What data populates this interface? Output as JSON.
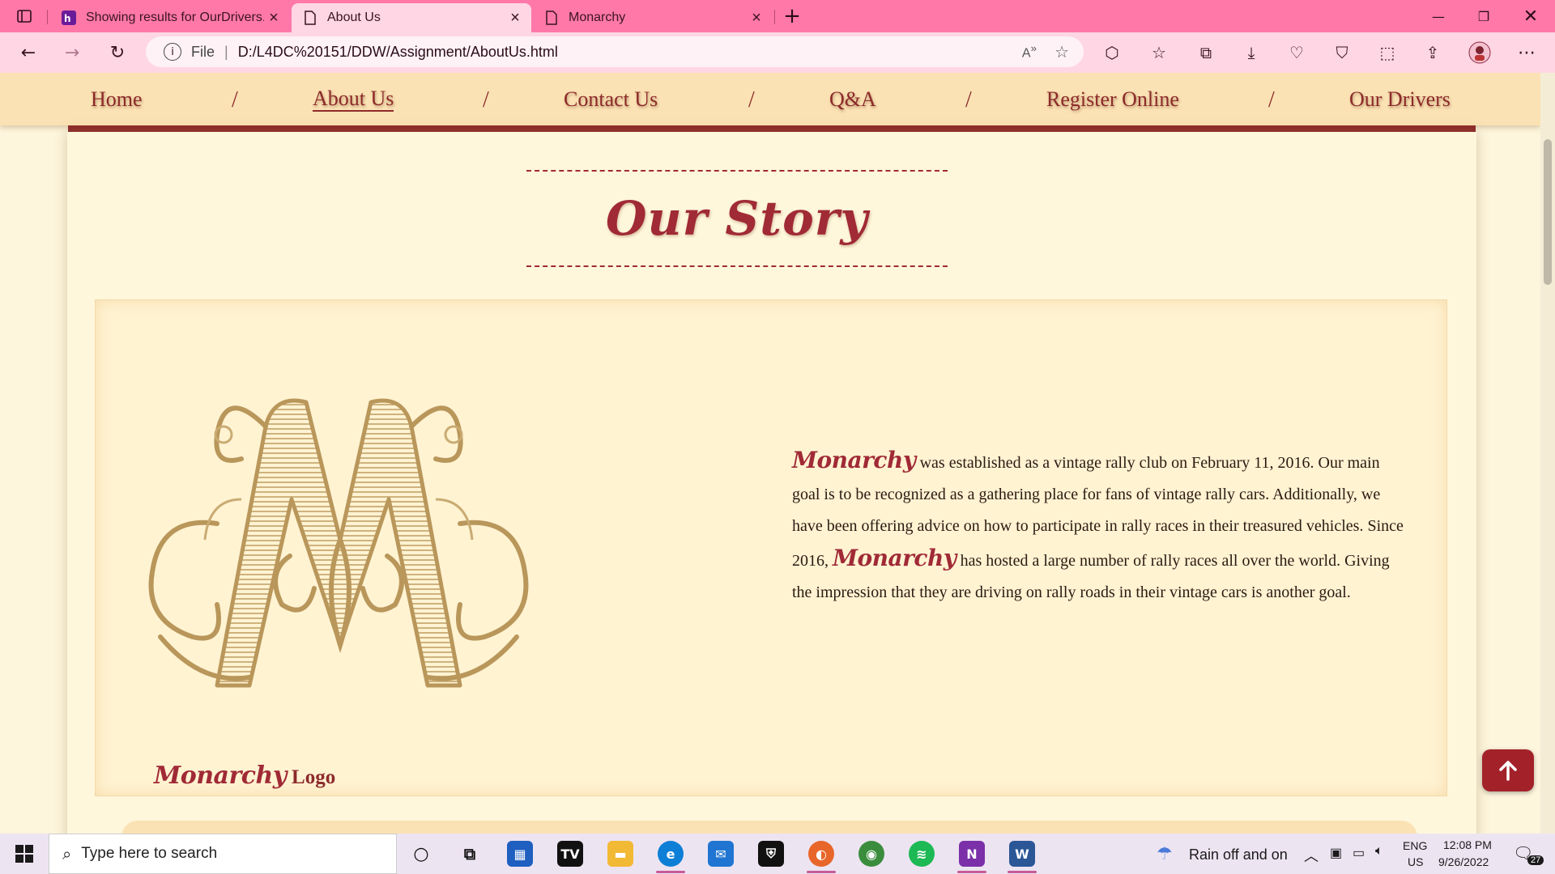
{
  "browser": {
    "tabs": [
      {
        "title": "Showing results for OurDrivers.h",
        "active": false
      },
      {
        "title": "About Us",
        "active": true
      },
      {
        "title": "Monarchy",
        "active": false
      }
    ],
    "new_tab_label": "+",
    "address": {
      "scheme_label": "File",
      "url": "D:/L4DC%20151/DDW/Assignment/AboutUs.html"
    }
  },
  "nav": {
    "items": [
      "Home",
      "About Us",
      "Contact Us",
      "Q&A",
      "Register Online",
      "Our Drivers"
    ],
    "separator": "/",
    "current": "About Us"
  },
  "story": {
    "title": "Our Story",
    "brand": "Monarchy",
    "paragraph_1": "was established as a vintage rally club on February 11, 2016. Our main goal is to be recognized as a gathering place for fans of vintage rally cars. Additionally, we have been offering advice on how to participate in rally races in their treasured vehicles. Since 2016,",
    "paragraph_2": "has hosted a large number of rally races all over the world. Giving the impression that they are driving on rally roads in their vintage cars is another goal.",
    "logo_caption_brand": "Monarchy",
    "logo_caption_text": "Logo",
    "logo_monogram": "M"
  },
  "back_to_top_icon": "arrow-up-icon",
  "taskbar": {
    "search_placeholder": "Type here to search",
    "weather": "Rain off and on",
    "lang_1": "ENG",
    "lang_2": "US",
    "time": "12:08 PM",
    "date": "9/26/2022",
    "notifications": "27"
  },
  "colors": {
    "tabstrip": "#ff78a8",
    "toolbar": "#ffd6e4",
    "accent": "#a02a36",
    "nav_bg": "#fbe2b4",
    "page_bg": "#fdf5dc"
  }
}
